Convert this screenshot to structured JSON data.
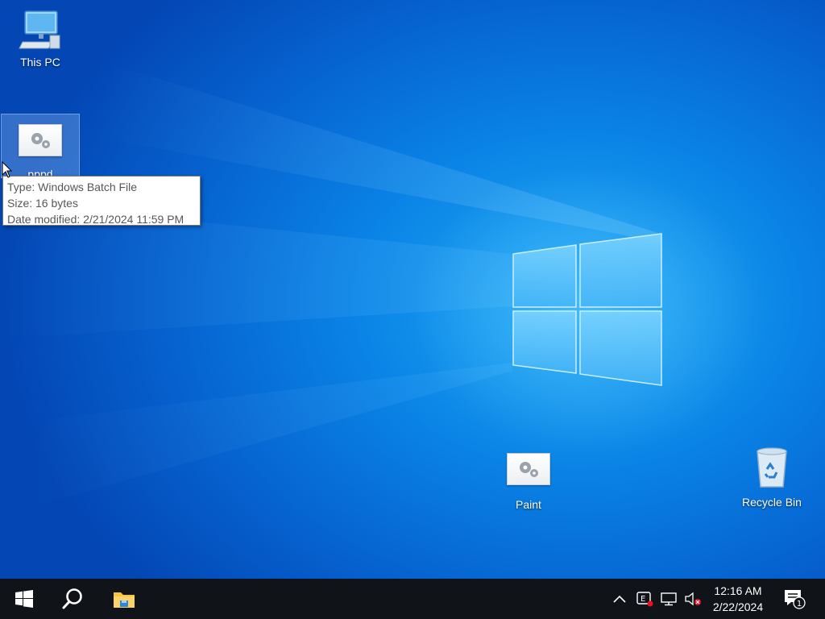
{
  "desktop": {
    "icons": [
      {
        "label": "This PC",
        "icon": "computer-icon"
      },
      {
        "label": "pppd",
        "icon": "batch-file-icon"
      },
      {
        "label": "Paint",
        "icon": "batch-file-icon"
      },
      {
        "label": "Recycle Bin",
        "icon": "recycle-bin-icon"
      }
    ]
  },
  "tooltip": {
    "type": "Type: Windows Batch File",
    "size": "Size: 16 bytes",
    "modified": "Date modified: 2/21/2024 11:59 PM"
  },
  "taskbar": {
    "start": "windows-logo-icon",
    "search": "search-icon",
    "explorer": "file-explorer-icon",
    "tray": [
      "chevron-up-icon",
      "keyboard-layout-icon",
      "network-icon",
      "volume-muted-icon"
    ],
    "clock": {
      "time": "12:16 AM",
      "date": "2/22/2024"
    },
    "notifications": {
      "icon": "action-center-icon",
      "count": "1"
    }
  },
  "colors": {
    "taskbar": "#101318",
    "accent": "#0a84e6",
    "error": "#e81123"
  }
}
